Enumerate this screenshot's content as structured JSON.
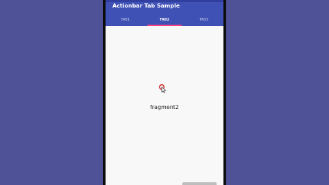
{
  "app": {
    "title": "Actionbar Tab Sample"
  },
  "tabs": [
    {
      "label": "TAB1",
      "active": false
    },
    {
      "label": "TAB2",
      "active": true
    },
    {
      "label": "TAB3",
      "active": false
    }
  ],
  "content": {
    "fragment_text": "fragment2"
  },
  "colors": {
    "background": "#4f5296",
    "appbar": "#3f51b5",
    "tab_indicator": "#ff4081",
    "screen": "#f8f8f8"
  }
}
